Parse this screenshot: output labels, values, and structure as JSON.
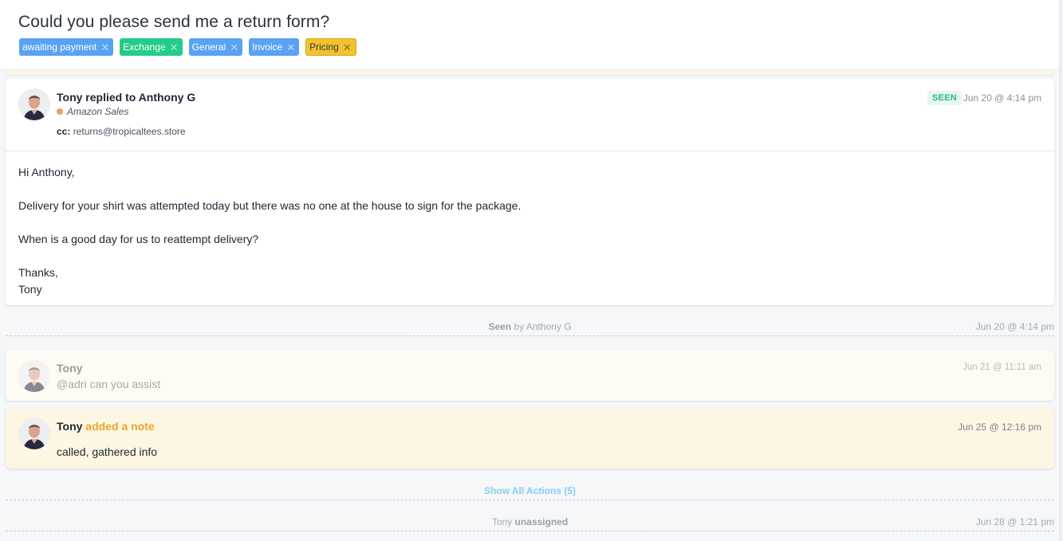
{
  "conversation": {
    "title": "Could you please send me a return form?",
    "tags": [
      {
        "label": "awaiting payment",
        "color": "#5aa2f2"
      },
      {
        "label": "Exchange",
        "color": "#24cc8a"
      },
      {
        "label": "General",
        "color": "#5aa2f2"
      },
      {
        "label": "Invoice",
        "color": "#5aa2f2"
      },
      {
        "label": "Pricing",
        "color": "#f2c230"
      }
    ]
  },
  "reply": {
    "author": "Tony",
    "action": "replied to",
    "recipient": "Anthony G",
    "header": "Tony replied to Anthony G",
    "inbox": "Amazon Sales",
    "inbox_dot_color": "#f59c62",
    "cc_label": "cc:",
    "cc_value": "returns@tropicaltees.store",
    "status_badge": "SEEN",
    "time": "Jun 20 @ 4:14 pm",
    "body": [
      "Hi Anthony,",
      "Delivery for your shirt was attempted today but there was no one at the house to sign for the package.",
      "When is a good day for us to reattempt delivery?",
      "Thanks,",
      "Tony"
    ]
  },
  "events": {
    "seen": {
      "strong": "Seen",
      "text": " by Anthony G",
      "time": "Jun 20 @ 4:14 pm"
    },
    "show_actions": {
      "label": "Show All Actions (5)"
    },
    "unassigned": {
      "actor": "Tony ",
      "strong": "unassigned",
      "time": "Jun 28 @ 1:21 pm"
    }
  },
  "mention": {
    "author": "Tony",
    "text": "@adri can you assist",
    "time": "Jun 21 @ 11:11 am"
  },
  "note": {
    "author": "Tony",
    "action": " added a note",
    "text": "called, gathered info",
    "time": "Jun 25 @ 12:16 pm",
    "accent_color": "#e8a62a"
  }
}
